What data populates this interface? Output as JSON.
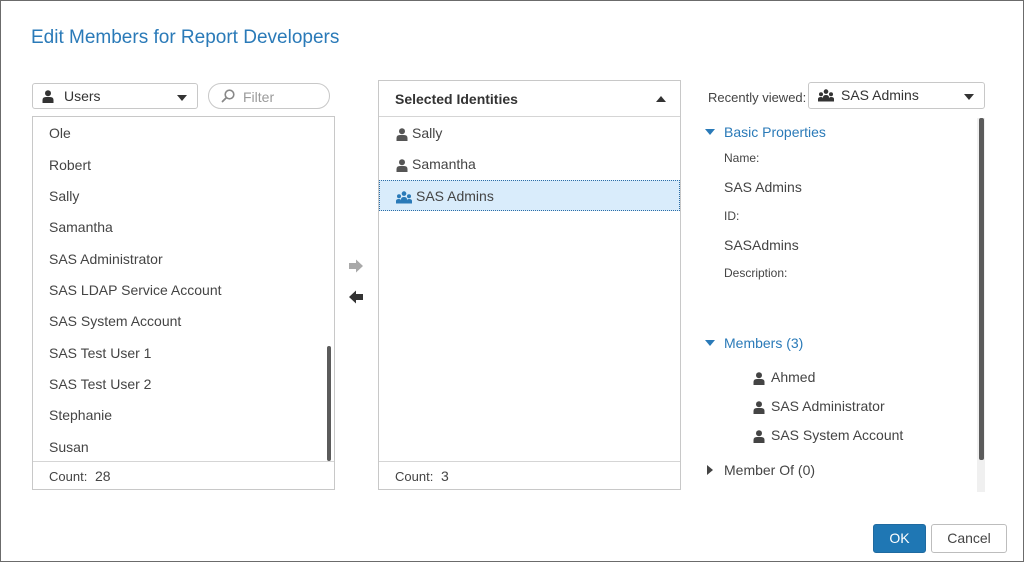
{
  "dialog": {
    "title": "Edit Members for Report Developers"
  },
  "source": {
    "type_dropdown": {
      "value": "Users"
    },
    "filter": {
      "placeholder": "Filter"
    },
    "items": [
      "Ole",
      "Robert",
      "Sally",
      "Samantha",
      "SAS Administrator",
      "SAS LDAP Service Account",
      "SAS System Account",
      "SAS Test User 1",
      "SAS Test User 2",
      "Stephanie",
      "Susan"
    ],
    "count_label": "Count:",
    "count": "28"
  },
  "selected": {
    "header": "Selected Identities",
    "items": [
      {
        "label": "Sally",
        "icon": "user-icon"
      },
      {
        "label": "Samantha",
        "icon": "user-icon"
      },
      {
        "label": "SAS Admins",
        "icon": "group-icon"
      }
    ],
    "count_label": "Count:",
    "count": "3"
  },
  "details": {
    "recently_viewed_label": "Recently viewed:",
    "recently_viewed_value": "SAS Admins",
    "basic_properties": {
      "title": "Basic Properties",
      "name_label": "Name:",
      "name_value": "SAS Admins",
      "id_label": "ID:",
      "id_value": "SASAdmins",
      "description_label": "Description:"
    },
    "members": {
      "title": "Members (3)",
      "items": [
        "Ahmed",
        "SAS Administrator",
        "SAS System Account"
      ]
    },
    "member_of": {
      "title": "Member Of (0)"
    }
  },
  "buttons": {
    "ok": "OK",
    "cancel": "Cancel"
  },
  "colors": {
    "accent": "#2a7ab8",
    "primary_button": "#1f77b4",
    "selection_bg": "#d9ecfb"
  }
}
